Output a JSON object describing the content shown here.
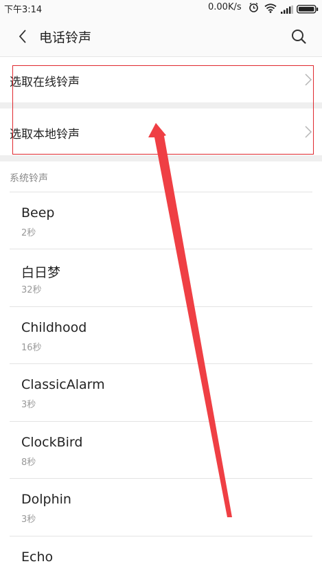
{
  "status_bar": {
    "time": "下午3:14",
    "net_speed": "0.00K/s",
    "icons": [
      "alarm-icon",
      "wifi-icon",
      "signal-icon",
      "battery-icon"
    ]
  },
  "header": {
    "back_icon": "back-chevron-icon",
    "title": "电话铃声",
    "search_icon": "search-icon"
  },
  "options": [
    {
      "label": "选取在线铃声"
    },
    {
      "label": "选取本地铃声"
    }
  ],
  "system_section": {
    "title": "系统铃声",
    "items": [
      {
        "name": "Beep",
        "duration": "2秒"
      },
      {
        "name": "白日梦",
        "duration": "32秒"
      },
      {
        "name": "Childhood",
        "duration": "16秒"
      },
      {
        "name": "ClassicAlarm",
        "duration": "3秒"
      },
      {
        "name": "ClockBird",
        "duration": "8秒"
      },
      {
        "name": "Dolphin",
        "duration": "3秒"
      },
      {
        "name": "Echo",
        "duration": ""
      }
    ]
  },
  "colors": {
    "annotation": "#e0282e",
    "accent_text": "#222222",
    "secondary_text": "#999999"
  }
}
